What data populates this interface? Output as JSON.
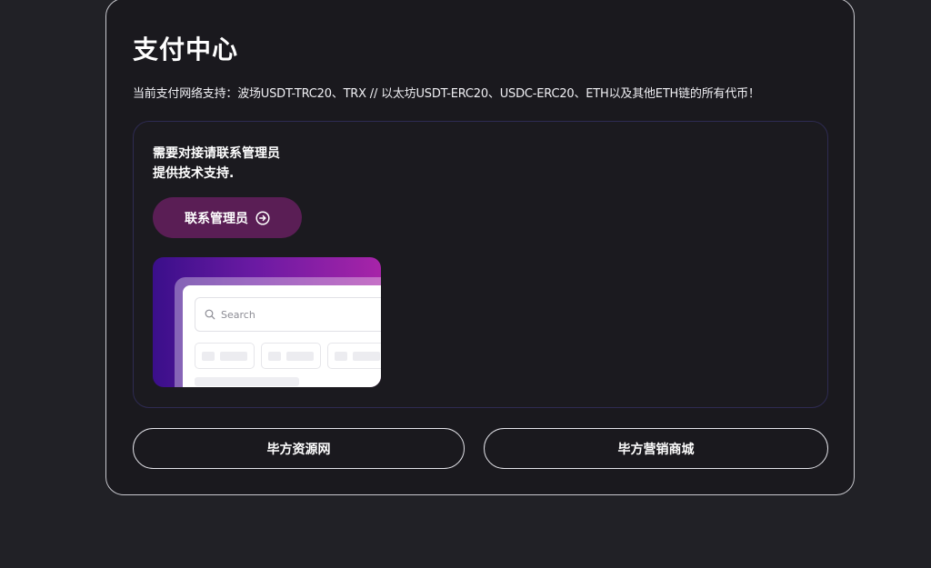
{
  "page": {
    "title": "支付中心",
    "subtitle": "当前支付网络支持：波场USDT-TRC20、TRX // 以太坊USDT-ERC20、USDC-ERC20、ETH以及其他ETH链的所有代币！"
  },
  "contact": {
    "line1": "需要对接请联系管理员",
    "line2": "提供技术支持.",
    "button_label": "联系管理员",
    "button_icon": "arrow-right-circle-icon"
  },
  "preview": {
    "search_placeholder": "Search",
    "search_icon": "search-icon"
  },
  "links": [
    {
      "label": "毕方资源网"
    },
    {
      "label": "毕方营销商城"
    }
  ],
  "colors": {
    "background": "#212126",
    "card": "#1a191e",
    "contact_button": "#5a1e55",
    "inner_border": "#2e2b52"
  }
}
